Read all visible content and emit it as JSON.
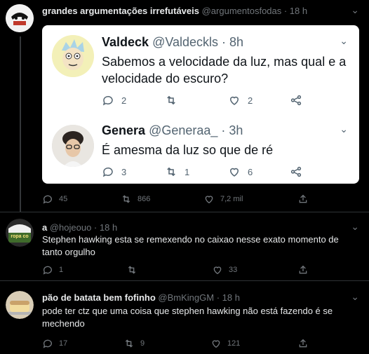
{
  "main_tweet": {
    "name": "grandes argumentações irrefutáveis",
    "handle": "@argumentosfodas · 18 h",
    "stats": {
      "replies": "45",
      "retweets": "866",
      "likes": "7,2 mil"
    },
    "embedded": [
      {
        "name": "Valdeck",
        "handle": "@Valdeckls · 8h",
        "text": "Sabemos a velocidade da luz, mas qual e a velocidade do escuro?",
        "stats": {
          "replies": "2",
          "retweets": "",
          "likes": "2"
        }
      },
      {
        "name": "Genera",
        "handle": "@Generaa_ · 3h",
        "text": "É amesma da luz so que de ré",
        "stats": {
          "replies": "3",
          "retweets": "1",
          "likes": "6"
        }
      }
    ]
  },
  "replies": [
    {
      "name": "a",
      "handle": "@hojeouo · 18 h",
      "avatar_caption": "ropa co",
      "text": "Stephen hawking esta se remexendo no caixao nesse exato momento de tanto orgulho",
      "stats": {
        "replies": "1",
        "retweets": "",
        "likes": "33"
      }
    },
    {
      "name": "pão de batata bem fofinho",
      "handle": "@BmKingGM · 18 h",
      "text": "pode ter ctz que uma coisa que stephen hawking não está fazendo é se mechendo",
      "stats": {
        "replies": "17",
        "retweets": "9",
        "likes": "121"
      }
    }
  ],
  "icons": [
    "reply-icon",
    "retweet-icon",
    "like-icon",
    "share-icon",
    "more-icon"
  ],
  "colors": {
    "background": "#000000",
    "muted": "#71767b",
    "card": "#ffffff"
  }
}
